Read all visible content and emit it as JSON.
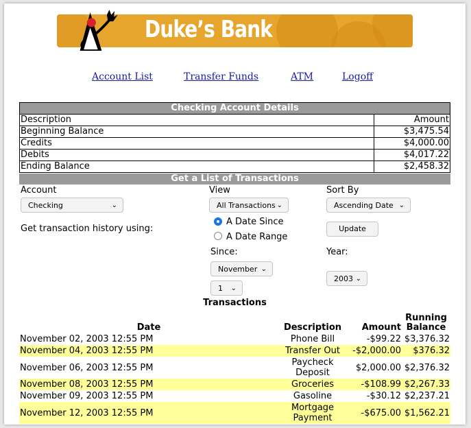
{
  "brand": {
    "title": "Duke’s Bank",
    "colors": {
      "banner": "#e6a52c",
      "link": "#1a1aa6",
      "header_bg": "#9a9a9a",
      "highlight": "#ffff99"
    }
  },
  "nav": {
    "account_list": "Account List",
    "transfer_funds": "Transfer Funds",
    "atm": "ATM",
    "logoff": "Logoff"
  },
  "details": {
    "heading": "Checking Account Details",
    "col_description": "Description",
    "col_amount": "Amount",
    "rows": [
      {
        "label": "Beginning Balance",
        "amount": "$3,475.54"
      },
      {
        "label": "Credits",
        "amount": "$4,000.00"
      },
      {
        "label": "Debits",
        "amount": "$4,017.22"
      },
      {
        "label": "Ending Balance",
        "amount": "$2,458.32"
      }
    ]
  },
  "form": {
    "heading": "Get a List of Transactions",
    "account_label": "Account",
    "account_value": "Checking",
    "view_label": "View",
    "view_value": "All Transactions",
    "sort_label": "Sort By",
    "sort_value": "Ascending Date",
    "history_label": "Get transaction history using:",
    "radio_since": "A Date Since",
    "radio_range": "A Date Range",
    "since_label": "Since:",
    "month_value": "November",
    "day_value": "1",
    "year_label": "Year:",
    "year_value": "2003",
    "update_label": "Update",
    "chevron_icon": "chevron-down-icon"
  },
  "transactions": {
    "title": "Transactions",
    "col_date": "Date",
    "col_description": "Description",
    "col_amount": "Amount",
    "col_running_1": "Running",
    "col_running_2": "Balance",
    "rows": [
      {
        "date": "November 02, 2003 12:55 PM",
        "desc1": "Phone Bill",
        "desc2": "",
        "amount": "-$99.22",
        "balance": "$3,376.32",
        "highlight": false
      },
      {
        "date": "November 04, 2003 12:55 PM",
        "desc1": "Transfer Out",
        "desc2": "",
        "amount": "-$2,000.00",
        "balance": "$376.32",
        "highlight": true
      },
      {
        "date": "November 06, 2003 12:55 PM",
        "desc1": "Paycheck",
        "desc2": "Deposit",
        "amount": "$2,000.00",
        "balance": "$2,376.32",
        "highlight": false
      },
      {
        "date": "November 08, 2003 12:55 PM",
        "desc1": "Groceries",
        "desc2": "",
        "amount": "-$108.99",
        "balance": "$2,267.33",
        "highlight": true
      },
      {
        "date": "November 09, 2003 12:55 PM",
        "desc1": "Gasoline",
        "desc2": "",
        "amount": "-$30.12",
        "balance": "$2,237.21",
        "highlight": false
      },
      {
        "date": "November 12, 2003 12:55 PM",
        "desc1": "Mortgage",
        "desc2": "Payment",
        "amount": "-$675.00",
        "balance": "$1,562.21",
        "highlight": true
      }
    ]
  }
}
